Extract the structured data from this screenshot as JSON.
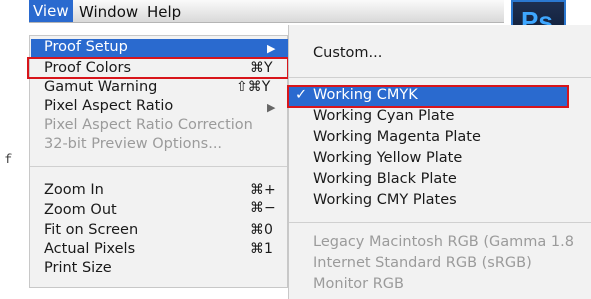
{
  "menubar": {
    "view": "View",
    "window": "Window",
    "help": "Help"
  },
  "app_logo": {
    "text": "Ps"
  },
  "menu": {
    "proof_setup": "Proof Setup",
    "proof_colors": "Proof Colors",
    "proof_colors_shortcut": "⌘Y",
    "gamut_warning": "Gamut Warning",
    "gamut_warning_shortcut": "⇧⌘Y",
    "pixel_aspect_ratio": "Pixel Aspect Ratio",
    "pixel_aspect_ratio_correction": "Pixel Aspect Ratio Correction",
    "preview_options": "32-bit Preview Options...",
    "zoom_in": "Zoom In",
    "zoom_in_shortcut": "⌘+",
    "zoom_out": "Zoom Out",
    "zoom_out_shortcut": "⌘−",
    "fit_on_screen": "Fit on Screen",
    "fit_on_screen_shortcut": "⌘0",
    "actual_pixels": "Actual Pixels",
    "actual_pixels_shortcut": "⌘1",
    "print_size": "Print Size"
  },
  "submenu": {
    "custom": "Custom...",
    "checkmark": "✓",
    "working_cmyk": "Working CMYK",
    "cyan_plate": "Working Cyan Plate",
    "magenta_plate": "Working Magenta Plate",
    "yellow_plate": "Working Yellow Plate",
    "black_plate": "Working Black Plate",
    "cmy_plates": "Working CMY Plates",
    "legacy_rgb": "Legacy Macintosh RGB (Gamma 1.8",
    "internet_rgb": "Internet Standard RGB (sRGB)",
    "monitor_rgb": "Monitor RGB"
  },
  "colors": {
    "highlight": "#2a6acf",
    "annotation": "#d8151b"
  }
}
